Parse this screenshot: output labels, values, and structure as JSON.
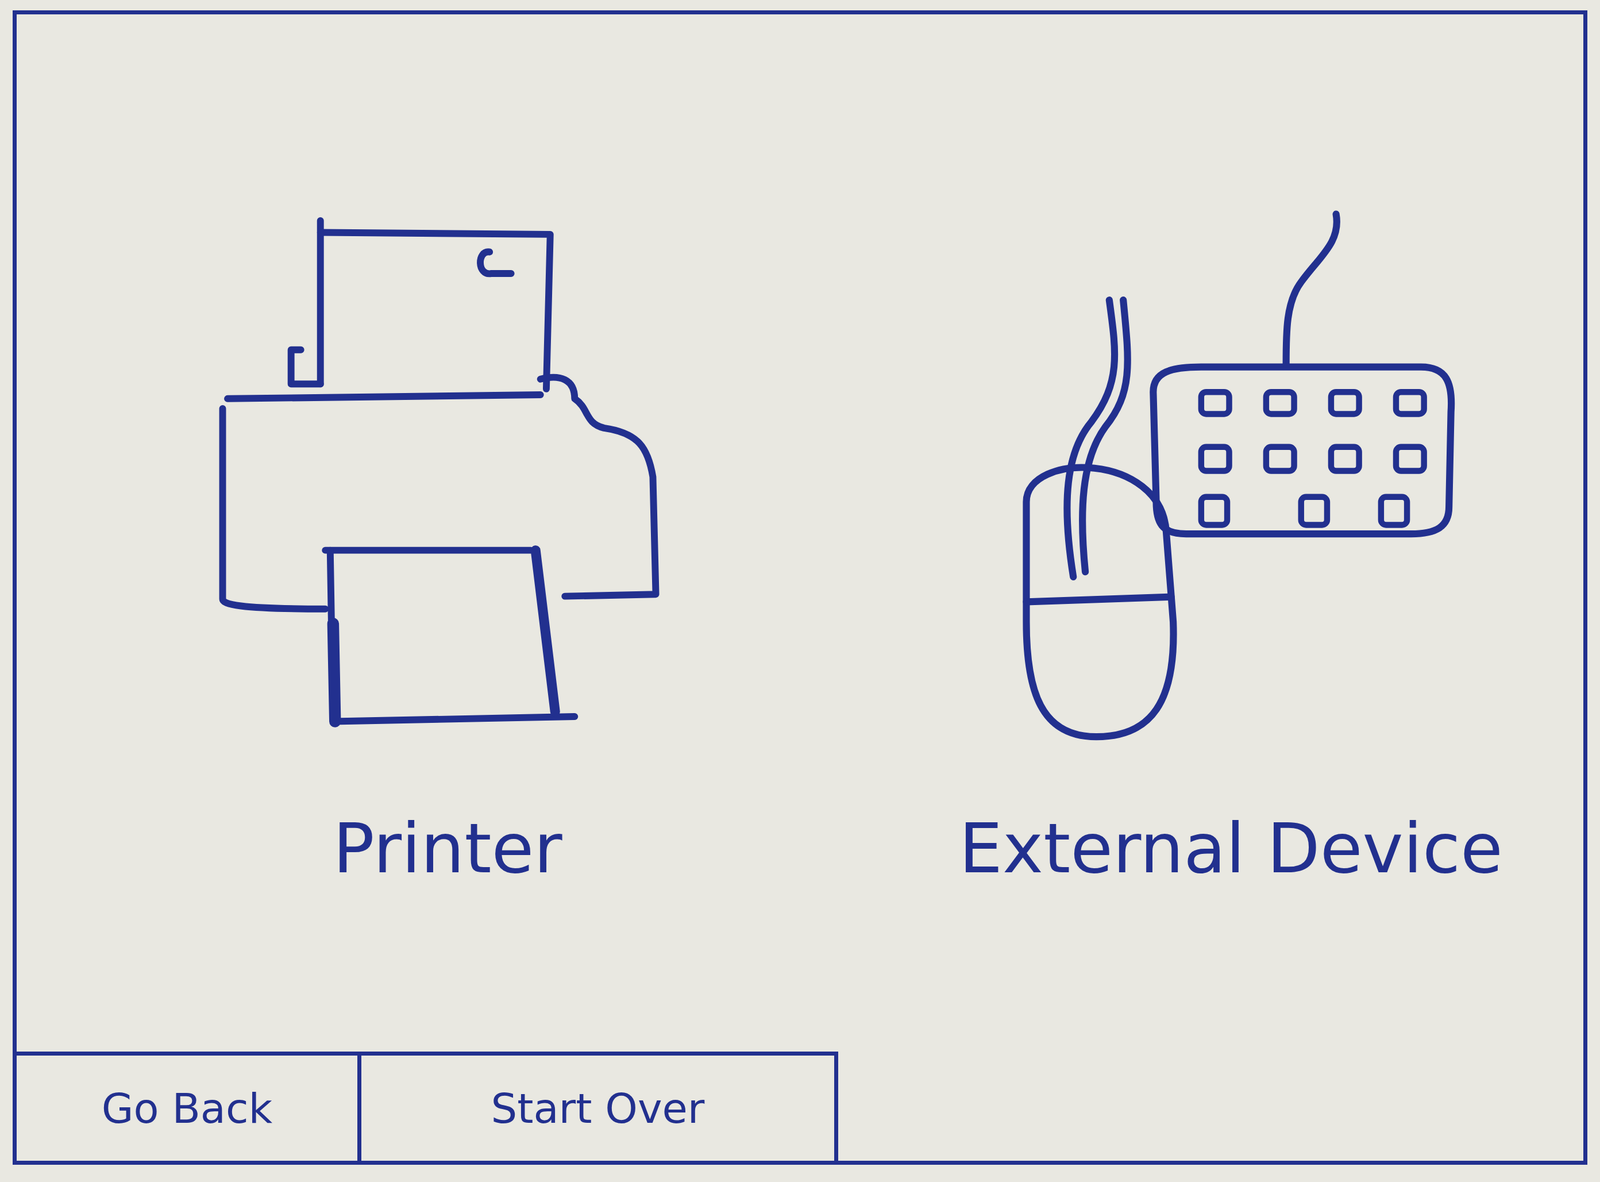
{
  "options": [
    {
      "label": "Printer",
      "kind": "printer"
    },
    {
      "label": "External Device",
      "kind": "peripheral"
    }
  ],
  "buttons": [
    "Go Back",
    "Start Over"
  ]
}
